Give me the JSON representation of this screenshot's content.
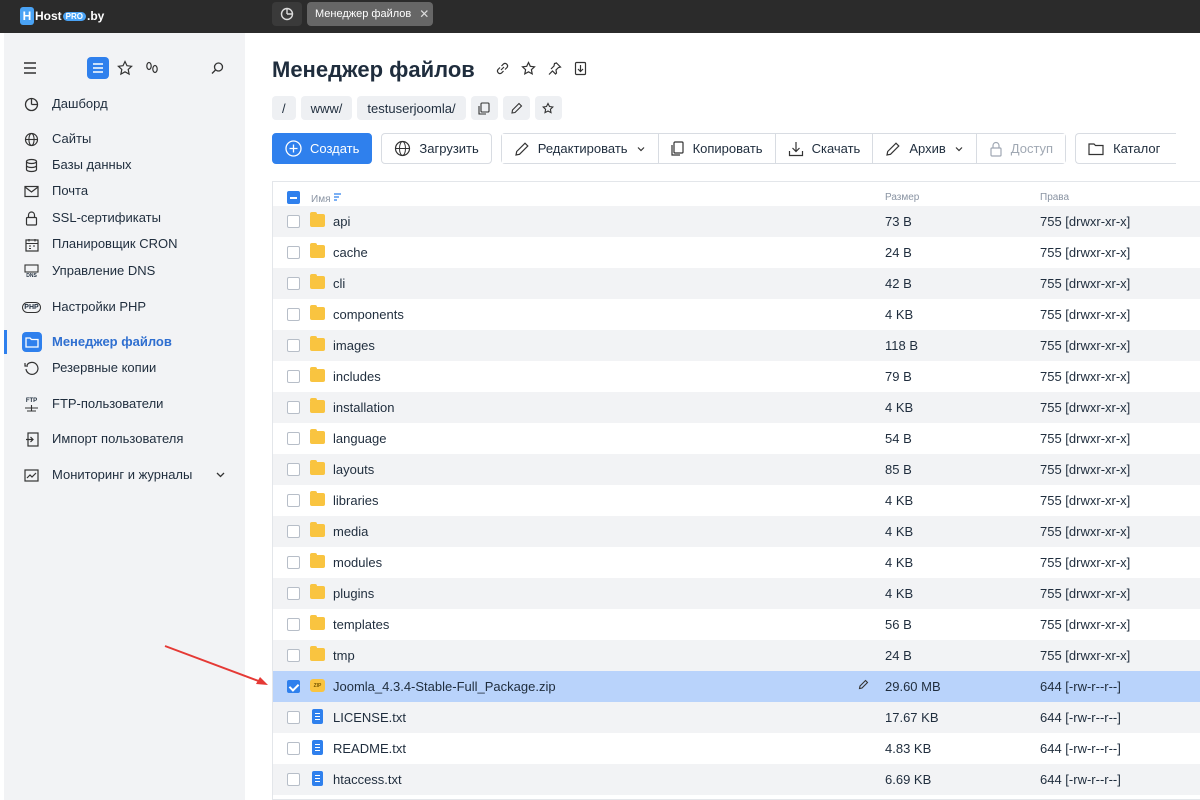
{
  "topbar": {
    "logo_prefix": "Host",
    "logo_pro": "PRO",
    "logo_suffix": ".by",
    "tab_label": "Менеджер файлов",
    "tab_close": "✕"
  },
  "sidebar": {
    "items": [
      {
        "label": "Дашборд",
        "icon": "dashboard-icon"
      },
      {
        "label": "Сайты",
        "icon": "globe-icon"
      },
      {
        "label": "Базы данных",
        "icon": "database-icon"
      },
      {
        "label": "Почта",
        "icon": "mail-icon"
      },
      {
        "label": "SSL-сертификаты",
        "icon": "lock-icon"
      },
      {
        "label": "Планировщик CRON",
        "icon": "calendar-icon"
      },
      {
        "label": "Управление DNS",
        "icon": "dns-icon"
      },
      {
        "label": "Настройки PHP",
        "icon": "php-icon"
      },
      {
        "label": "Менеджер файлов",
        "icon": "folder-icon",
        "active": true
      },
      {
        "label": "Резервные копии",
        "icon": "backup-icon"
      },
      {
        "label": "FTP-пользователи",
        "icon": "ftp-icon"
      },
      {
        "label": "Импорт пользователя",
        "icon": "user-import-icon"
      },
      {
        "label": "Мониторинг и журналы",
        "icon": "monitoring-icon"
      }
    ],
    "icon_dns_text": "DNS",
    "icon_php_text": "PHP",
    "icon_ftp_text": "FTP"
  },
  "main": {
    "title": "Менеджер файлов",
    "breadcrumbs": [
      "/",
      "www/",
      "testuserjoomla/"
    ],
    "toolbar": {
      "create": "Создать",
      "upload": "Загрузить",
      "edit": "Редактировать",
      "copy": "Копировать",
      "download": "Скачать",
      "archive": "Архив",
      "access": "Доступ",
      "catalog": "Каталог"
    },
    "table": {
      "headers": {
        "name": "Имя",
        "size": "Размер",
        "perms": "Права"
      },
      "rows": [
        {
          "name": "api",
          "size": "73 B",
          "perms": "755 [drwxr-xr-x]",
          "type": "folder"
        },
        {
          "name": "cache",
          "size": "24 B",
          "perms": "755 [drwxr-xr-x]",
          "type": "folder"
        },
        {
          "name": "cli",
          "size": "42 B",
          "perms": "755 [drwxr-xr-x]",
          "type": "folder"
        },
        {
          "name": "components",
          "size": "4 KB",
          "perms": "755 [drwxr-xr-x]",
          "type": "folder"
        },
        {
          "name": "images",
          "size": "118 B",
          "perms": "755 [drwxr-xr-x]",
          "type": "folder"
        },
        {
          "name": "includes",
          "size": "79 B",
          "perms": "755 [drwxr-xr-x]",
          "type": "folder"
        },
        {
          "name": "installation",
          "size": "4 KB",
          "perms": "755 [drwxr-xr-x]",
          "type": "folder"
        },
        {
          "name": "language",
          "size": "54 B",
          "perms": "755 [drwxr-xr-x]",
          "type": "folder"
        },
        {
          "name": "layouts",
          "size": "85 B",
          "perms": "755 [drwxr-xr-x]",
          "type": "folder"
        },
        {
          "name": "libraries",
          "size": "4 KB",
          "perms": "755 [drwxr-xr-x]",
          "type": "folder"
        },
        {
          "name": "media",
          "size": "4 KB",
          "perms": "755 [drwxr-xr-x]",
          "type": "folder"
        },
        {
          "name": "modules",
          "size": "4 KB",
          "perms": "755 [drwxr-xr-x]",
          "type": "folder"
        },
        {
          "name": "plugins",
          "size": "4 KB",
          "perms": "755 [drwxr-xr-x]",
          "type": "folder"
        },
        {
          "name": "templates",
          "size": "56 B",
          "perms": "755 [drwxr-xr-x]",
          "type": "folder"
        },
        {
          "name": "tmp",
          "size": "24 B",
          "perms": "755 [drwxr-xr-x]",
          "type": "folder"
        },
        {
          "name": "Joomla_4.3.4-Stable-Full_Package.zip",
          "size": "29.60 MB",
          "perms": "644 [-rw-r--r--]",
          "type": "zip",
          "selected": true
        },
        {
          "name": "LICENSE.txt",
          "size": "17.67 KB",
          "perms": "644 [-rw-r--r--]",
          "type": "txt"
        },
        {
          "name": "README.txt",
          "size": "4.83 KB",
          "perms": "644 [-rw-r--r--]",
          "type": "txt"
        },
        {
          "name": "htaccess.txt",
          "size": "6.69 KB",
          "perms": "644 [-rw-r--r--]",
          "type": "txt"
        }
      ],
      "zip_badge": "ZIP"
    }
  },
  "colors": {
    "accent": "#2f80ed",
    "selected_row": "#b9d3fb",
    "folder": "#f9c440",
    "arrow": "#e53935"
  }
}
